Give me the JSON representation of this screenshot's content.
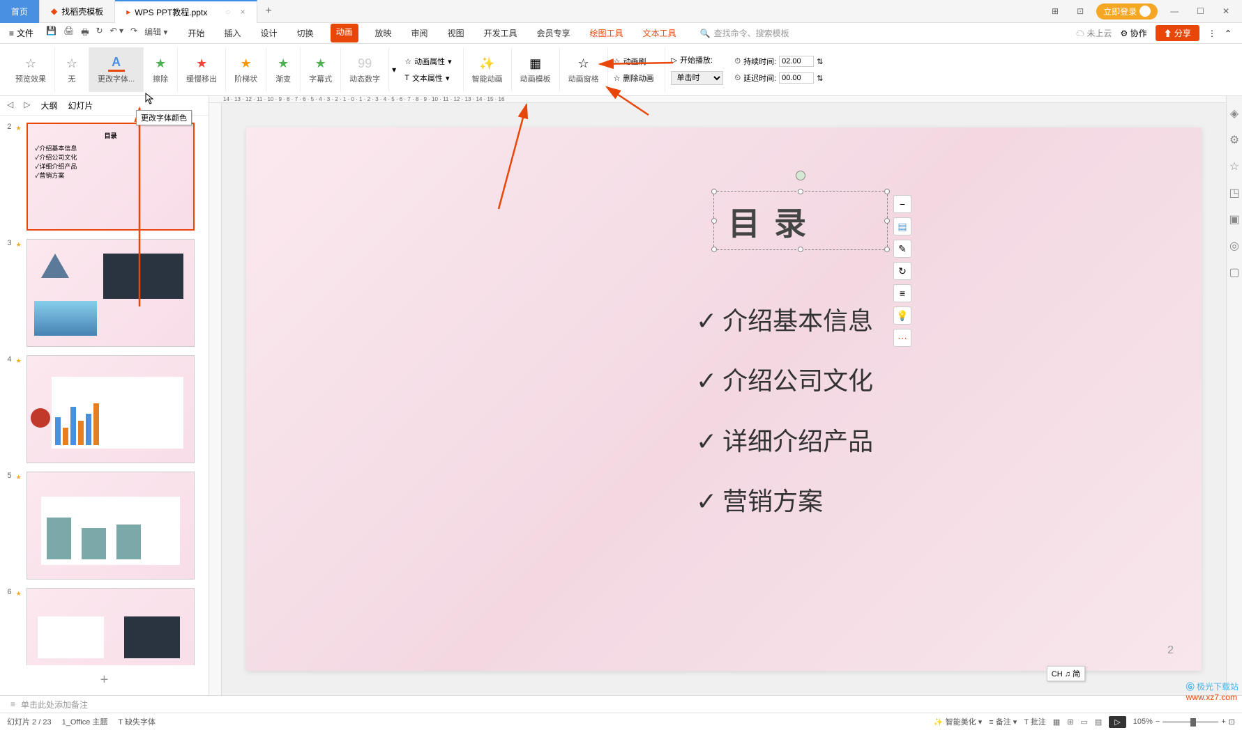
{
  "tabs": {
    "home": "首页",
    "template": "找稻壳模板",
    "doc": "WPS PPT教程.pptx"
  },
  "login_btn": "立即登录",
  "file_menu": "文件",
  "menu": {
    "start": "开始",
    "insert": "插入",
    "design": "设计",
    "transition": "切换",
    "animation": "动画",
    "slideshow": "放映",
    "review": "审阅",
    "view": "视图",
    "devtools": "开发工具",
    "vip": "会员专享",
    "drawtools": "绘图工具",
    "texttools": "文本工具"
  },
  "search_placeholder": "查找命令、搜索模板",
  "cloud_status": "未上云",
  "collab": "协作",
  "share": "分享",
  "ribbon": {
    "preview": "预览效果",
    "none": "无",
    "change_font": "更改字体...",
    "erase": "擦除",
    "slow_move": "缓慢移出",
    "step": "阶梯状",
    "fade": "渐变",
    "subtitle": "字幕式",
    "dynamic_num": "动态数字",
    "anim_prop": "动画属性",
    "text_prop": "文本属性",
    "smart_anim": "智能动画",
    "anim_template": "动画模板",
    "anim_pane": "动画窗格",
    "anim_brush": "动画刷",
    "delete_anim": "删除动画",
    "start_play": "开始播放:",
    "start_play_val": "单击时",
    "duration": "持续时间:",
    "duration_val": "02.00",
    "delay": "延迟时间:",
    "delay_val": "00.00"
  },
  "tooltip": "更改字体颜色",
  "side_tabs": {
    "outline": "大纲",
    "slides": "幻灯片"
  },
  "thumbs": [
    {
      "num": "2",
      "title": "目录",
      "items": [
        "介绍基本信息",
        "介绍公司文化",
        "详细介绍产品",
        "营销方案"
      ]
    },
    {
      "num": "3"
    },
    {
      "num": "4"
    },
    {
      "num": "5"
    },
    {
      "num": "6"
    }
  ],
  "slide": {
    "title": "目录",
    "items": [
      "介绍基本信息",
      "介绍公司文化",
      "详细介绍产品",
      "营销方案"
    ],
    "page_num": "2"
  },
  "notes_placeholder": "单击此处添加备注",
  "ime": "CH ♫ 简",
  "status": {
    "slide_info": "幻灯片 2 / 23",
    "theme": "1_Office 主题",
    "missing_font": "缺失字体",
    "smart_beautify": "智能美化",
    "notes": "备注",
    "comments": "批注",
    "zoom": "105%"
  },
  "watermark": {
    "brand": "极光下载站",
    "url": "www.xz7.com"
  }
}
